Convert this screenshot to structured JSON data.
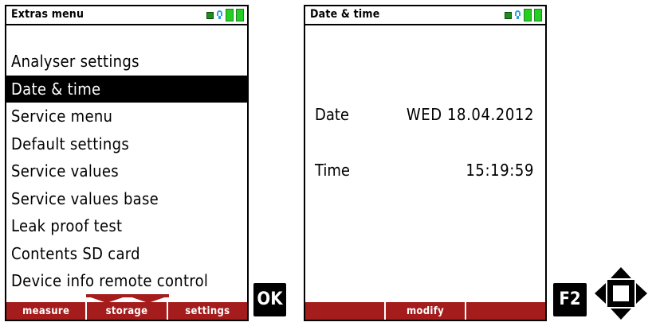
{
  "left_screen": {
    "title": "Extras menu",
    "menu_items": [
      {
        "label": "Analyser settings"
      },
      {
        "label": "Date & time",
        "selected": true
      },
      {
        "label": "Service menu"
      },
      {
        "label": "Default settings"
      },
      {
        "label": "Service values"
      },
      {
        "label": "Service values base"
      },
      {
        "label": "Leak proof test"
      },
      {
        "label": "Contents SD card"
      },
      {
        "label": "Device info remote control"
      }
    ],
    "softkeys": [
      "measure",
      "storage",
      "settings"
    ]
  },
  "right_screen": {
    "title": "Date & time",
    "date_label": "Date",
    "date_value": "WED 18.04.2012",
    "time_label": "Time",
    "time_value": "15:19:59",
    "softkeys": [
      "",
      "modify",
      ""
    ]
  },
  "keys": {
    "ok": "OK",
    "f2": "F2"
  },
  "colors": {
    "softkey_bar": "#a41c1c",
    "battery": "#22d022",
    "signal": "#29a3e3",
    "selection": "#000000"
  },
  "icons": [
    "status-square-icon",
    "wifi-signal-icon",
    "battery-icon",
    "navigation-dpad-icon"
  ]
}
